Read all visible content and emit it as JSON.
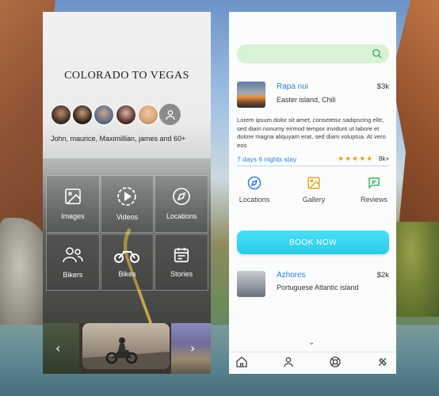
{
  "colors": {
    "accent_blue": "#2f7de0",
    "cta": "#2ccbe9",
    "search_bg": "#d9f1d4",
    "star": "#e6a21a",
    "gallery_orange": "#e6a21a",
    "reviews_green": "#3bb36a"
  },
  "trip": {
    "title": "COLORADO TO VEGAS",
    "members_text": "John, maurice, Maximillian, james and 60+",
    "avatars": [
      "avatar-1",
      "avatar-2",
      "avatar-3",
      "avatar-4",
      "avatar-5"
    ],
    "more_icon": "user-icon"
  },
  "tiles": [
    {
      "label": "Images",
      "icon": "image-icon"
    },
    {
      "label": "Videos",
      "icon": "play-icon"
    },
    {
      "label": "Locations",
      "icon": "compass-icon"
    },
    {
      "label": "Bikers",
      "icon": "users-icon"
    },
    {
      "label": "Bikes",
      "icon": "motorcycle-icon"
    },
    {
      "label": "Stories",
      "icon": "calendar-icon"
    }
  ],
  "carousel": {
    "prev": "‹",
    "next": "›"
  },
  "search": {
    "placeholder": "",
    "icon": "search-icon"
  },
  "listings": [
    {
      "place": "Rapa nui",
      "region": "Easter island, Chili",
      "price": "$3k",
      "description": "Lorem ipsum dolor sit amet, consetetur sadipscing elitr, sed diam nonumy eirmod tempor invidunt ut labore et dolore magna aliquyam erat, sed diam voluptua. At vero eos",
      "duration": "7 days 6 nights stay",
      "rating": 4.5,
      "stars": "★★★★★",
      "reviews": "8k+"
    },
    {
      "place": "Azhores",
      "region": "Portuguese Atlantic island",
      "price": "$2k"
    }
  ],
  "actions": [
    {
      "label": "Locations",
      "icon": "compass-icon"
    },
    {
      "label": "Gallery",
      "icon": "image-icon"
    },
    {
      "label": "Reviews",
      "icon": "chat-icon"
    }
  ],
  "cta": {
    "label": "BOOK NOW"
  },
  "scroll_hint": "⌄",
  "tabbar": [
    {
      "icon": "home-icon"
    },
    {
      "icon": "user-icon"
    },
    {
      "icon": "support-icon"
    },
    {
      "icon": "bell-icon"
    }
  ]
}
